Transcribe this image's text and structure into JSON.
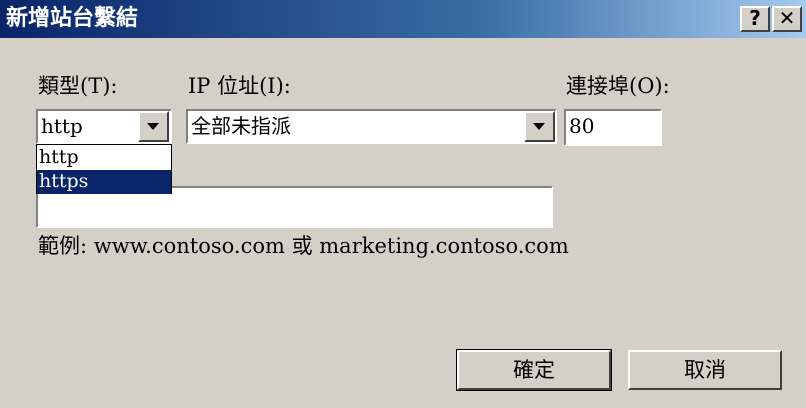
{
  "window": {
    "title": "新增站台繫結",
    "help_label": "?",
    "close_label": "✕"
  },
  "type_field": {
    "label": "類型(T):",
    "value": "http",
    "options": [
      "http",
      "https"
    ],
    "highlighted": "https"
  },
  "ip_field": {
    "label": "IP 位址(I):",
    "value": "全部未指派"
  },
  "port_field": {
    "label": "連接埠(O):",
    "value": "80"
  },
  "hostname_field": {
    "value": ""
  },
  "example": {
    "text": "範例: www.contoso.com 或 marketing.contoso.com"
  },
  "buttons": {
    "ok": "確定",
    "cancel": "取消"
  },
  "icons": {
    "dropdown": "chevron-down-icon",
    "help": "help-icon",
    "close": "close-icon"
  },
  "colors": {
    "titlebar_start": "#0a246a",
    "titlebar_end": "#a6caf0",
    "selection": "#0a246a",
    "face": "#d4d0c8"
  }
}
